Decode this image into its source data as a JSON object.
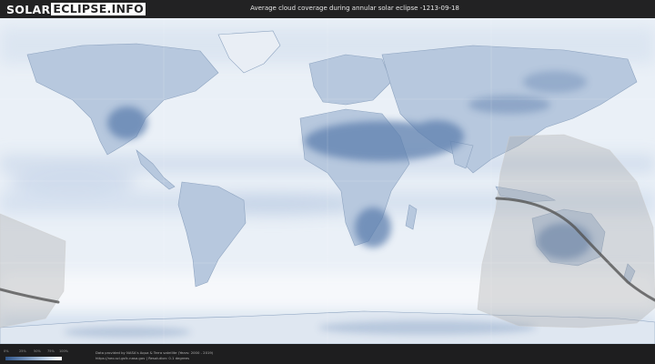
{
  "logo": {
    "part1": "SOLAR",
    "part2": "ECLIPSE.INFO"
  },
  "title": "Average cloud coverage during annular solar eclipse -1213-09-18",
  "legend": {
    "ticks": [
      "0%",
      "25%",
      "50%",
      "75%",
      "100%"
    ],
    "colors": [
      "#2f5487",
      "#6d8cb5",
      "#b4c8df",
      "#ffffff"
    ]
  },
  "credits": {
    "line1": "Data provided by NASA's Aqua & Terra satellite (Years: 2000 - 2019)",
    "line2": "https://neo.sci.gsfc.nasa.gov | Resolution: 0.1 degrees"
  },
  "colors": {
    "ocean": "#eef3f9",
    "cloud_low": "#5d7fae",
    "eclipse_zone": "#a8a8a8",
    "path_line": "#555555"
  }
}
